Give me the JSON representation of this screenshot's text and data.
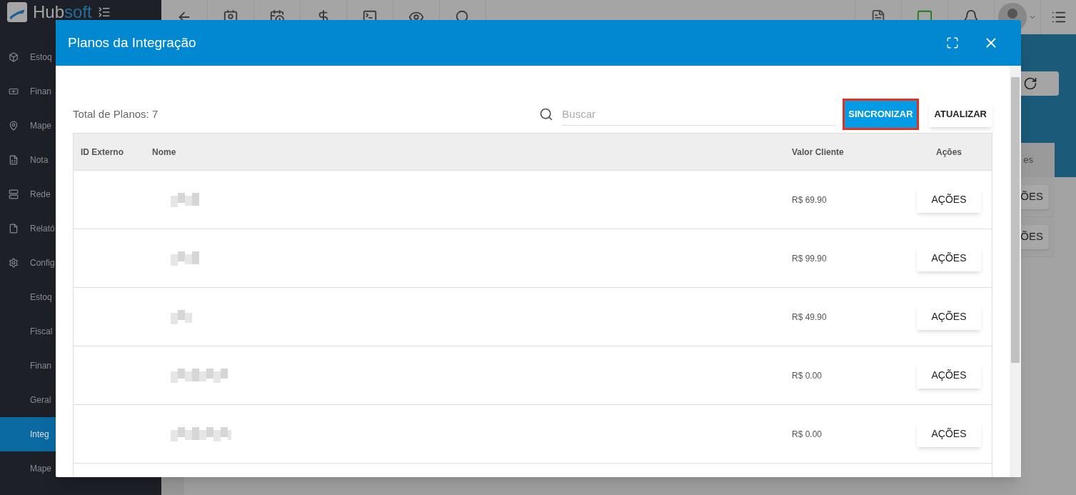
{
  "app": {
    "brand_prefix": "Hub",
    "brand_suffix": "soft"
  },
  "sidebar": {
    "items": [
      {
        "label": "Estoq",
        "selected": false
      },
      {
        "label": "Finan",
        "selected": false
      },
      {
        "label": "Mape",
        "selected": false
      },
      {
        "label": "Nota",
        "selected": false
      },
      {
        "label": "Rede",
        "selected": false
      },
      {
        "label": "Relató",
        "selected": false
      },
      {
        "label": "Config",
        "selected": false
      },
      {
        "label": "Estoq",
        "selected": false
      },
      {
        "label": "Fiscal",
        "selected": false
      },
      {
        "label": "Finan",
        "selected": false
      },
      {
        "label": "Geral",
        "selected": false
      },
      {
        "label": "Integ",
        "selected": true
      },
      {
        "label": "Mape",
        "selected": false
      }
    ]
  },
  "background": {
    "column_header": "es",
    "buttons": [
      "ÕES",
      "ÕES"
    ]
  },
  "dialog": {
    "title": "Planos da Integração",
    "total": "Total de Planos: 7",
    "search": {
      "placeholder": "Buscar"
    },
    "sync_button": {
      "label": "SINCRONIZAR",
      "highlighted": true
    },
    "refresh_button": "ATUALIZAR",
    "table": {
      "columns": [
        "ID Externo",
        "Nome",
        "Valor Cliente",
        "Ações"
      ],
      "rows": [
        {
          "valor_cliente": "R$ 69.90",
          "action": "AÇÕES"
        },
        {
          "valor_cliente": "R$ 99.90",
          "action": "AÇÕES"
        },
        {
          "valor_cliente": "R$ 49.90",
          "action": "AÇÕES"
        },
        {
          "valor_cliente": "R$ 0.00",
          "action": "AÇÕES"
        },
        {
          "valor_cliente": "R$ 0.00",
          "action": "AÇÕES"
        }
      ]
    }
  }
}
